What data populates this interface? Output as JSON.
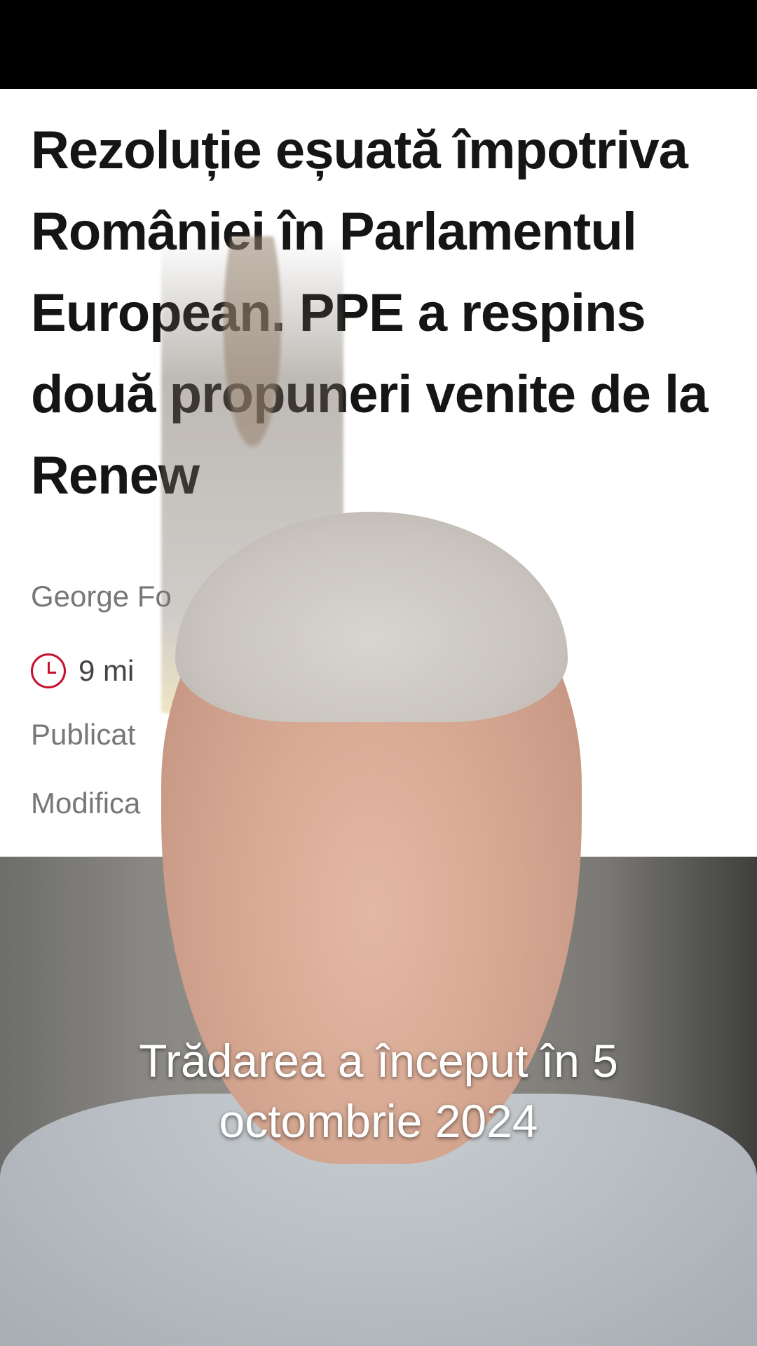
{
  "article": {
    "headline": "Rezoluție eșuată împotriva României în Parlamentul European. PPE a respins două propuneri venite de la Renew",
    "author": "George Fo",
    "read_time": "9 mi",
    "published_label": "Publicat",
    "modified_label": "Modifica"
  },
  "video": {
    "caption_line1": "Trădarea a început în 5",
    "caption_line2": "octombrie 2024"
  },
  "colors": {
    "accent": "#c8102e",
    "headline": "#151515",
    "meta": "#777777"
  },
  "icons": [
    "clock-icon"
  ]
}
